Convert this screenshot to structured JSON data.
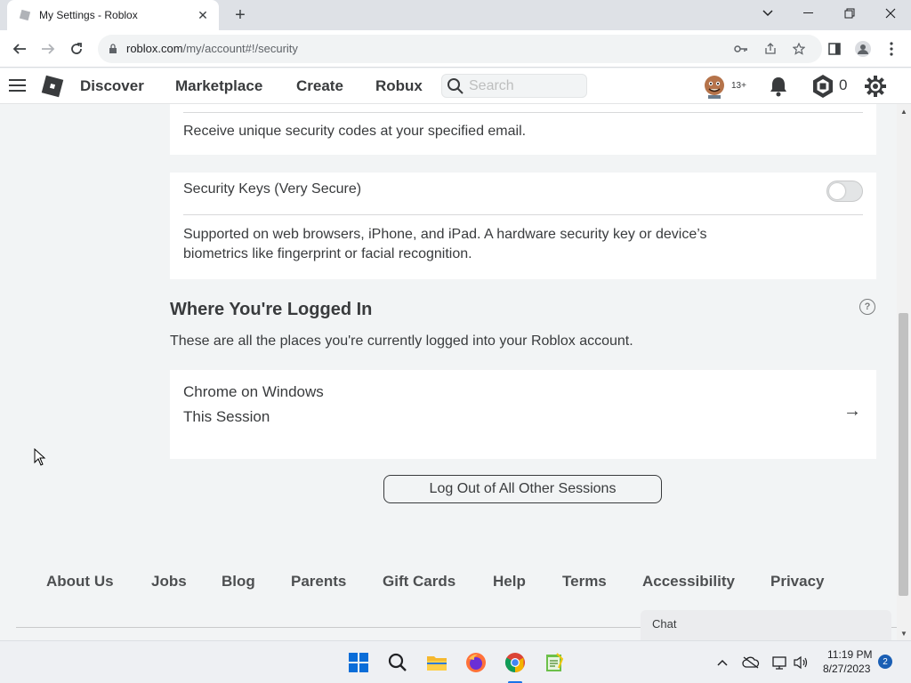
{
  "browser": {
    "tab_title": "My Settings - Roblox",
    "url_host": "roblox.com",
    "url_path": "/my/account#!/security",
    "new_tab_glyph": "+",
    "close_glyph": "✕"
  },
  "roblox_nav": {
    "links": [
      "Discover",
      "Marketplace",
      "Create",
      "Robux"
    ],
    "search_placeholder": "Search",
    "age_badge": "13+",
    "robux_balance": "0"
  },
  "security": {
    "email_desc": "Receive unique security codes at your specified email.",
    "security_keys_title": "Security Keys (Very Secure)",
    "security_keys_enabled": false,
    "security_keys_desc_line1": "Supported on web browsers, iPhone, and iPad. A hardware security key or device’s",
    "security_keys_desc_line2": "biometrics like fingerprint or facial recognition."
  },
  "sessions": {
    "title": "Where You're Logged In",
    "help_glyph": "?",
    "description": "These are all the places you're currently logged into your Roblox account.",
    "items": [
      {
        "device": "Chrome on Windows",
        "label": "This Session",
        "arrow": "→"
      }
    ],
    "logout_button": "Log Out of All Other Sessions"
  },
  "footer": {
    "links": [
      "About Us",
      "Jobs",
      "Blog",
      "Parents",
      "Gift Cards",
      "Help",
      "Terms",
      "Accessibility",
      "Privacy"
    ]
  },
  "chat": {
    "label": "Chat"
  },
  "taskbar": {
    "time": "11:19 PM",
    "date": "8/27/2023",
    "notification_count": "2"
  },
  "colors": {
    "page_bg": "#f2f4f5",
    "card_bg": "#ffffff",
    "text": "#393b3d",
    "accent_blue": "#1a73e8"
  }
}
